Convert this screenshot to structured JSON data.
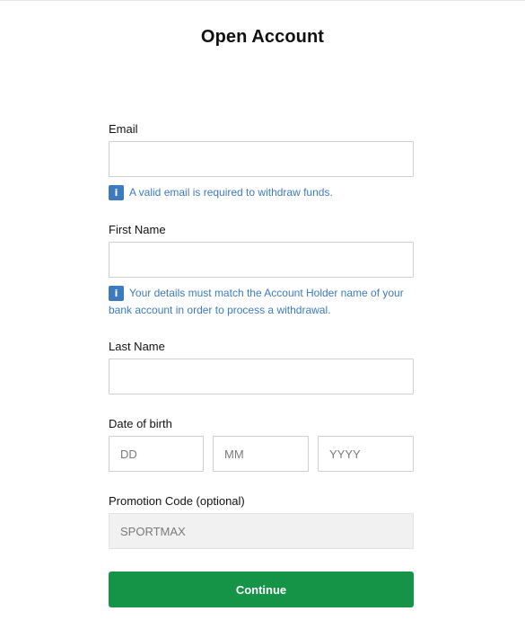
{
  "page": {
    "title": "Open Account"
  },
  "form": {
    "email": {
      "label": "Email",
      "value": "",
      "placeholder": "",
      "hint": "A valid email is required to withdraw funds."
    },
    "first_name": {
      "label": "First Name",
      "value": "",
      "placeholder": "",
      "hint": "Your details must match the Account Holder name of your bank account in order to process a withdrawal."
    },
    "last_name": {
      "label": "Last Name",
      "value": "",
      "placeholder": ""
    },
    "date_of_birth": {
      "label": "Date of birth",
      "day_placeholder": "DD",
      "month_placeholder": "MM",
      "year_placeholder": "YYYY"
    },
    "promo_code": {
      "label": "Promotion Code (optional)",
      "value": "SPORTMAX"
    },
    "continue_label": "Continue"
  },
  "icons": {
    "info": "info-icon"
  },
  "colors": {
    "primary_button": "#159447",
    "info_text": "#3d7bbf",
    "disabled_field": "#f1f1f1"
  }
}
